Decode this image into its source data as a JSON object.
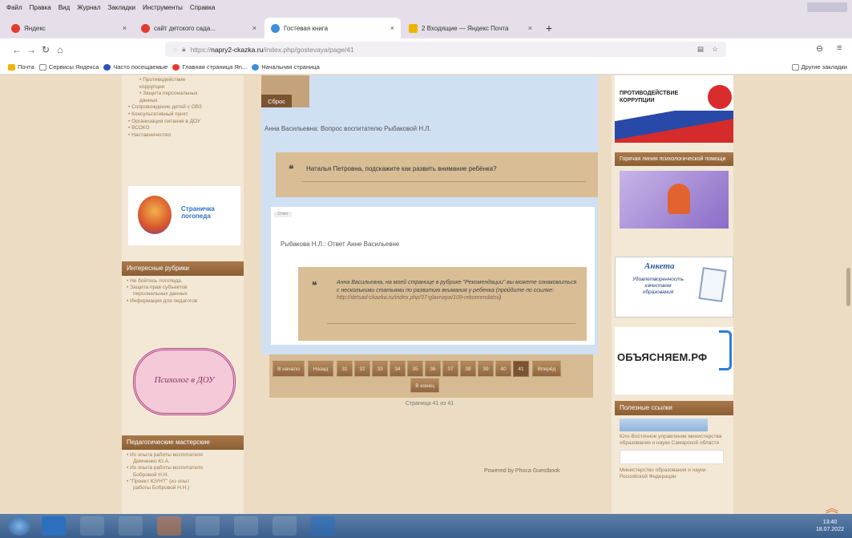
{
  "menubar": {
    "items": [
      "Файл",
      "Правка",
      "Вид",
      "Журнал",
      "Закладки",
      "Инструменты",
      "Справка"
    ]
  },
  "tabs": [
    {
      "label": "Яндекс",
      "color": "#e33b2e"
    },
    {
      "label": "сайт детского сада...",
      "color": "#e33b2e"
    },
    {
      "label": "Гостевая книга",
      "color": "#3d8edb",
      "active": true
    },
    {
      "label": "2 Входящие — Яндекс Почта",
      "color": "#f0b400"
    }
  ],
  "nav": {
    "url_prefix": "https://",
    "url_host": "napry2-ckazka.ru",
    "url_rest": "/index.php/gostevaya/page/41"
  },
  "bookmarks": {
    "items": [
      "Почта",
      "Сервисы Яндекса",
      "Часто посещаемые",
      "Главная страница Яn...",
      "Начальная страница"
    ],
    "other": "Другие закладки"
  },
  "left": {
    "nav_items": [
      {
        "label": "• Противодействие",
        "sub": true
      },
      {
        "label": "коррупции",
        "sub": true
      },
      {
        "label": "• Защита персональных",
        "sub": true
      },
      {
        "label": "данных",
        "sub": true
      },
      {
        "label": "• Сопровождение детей с ОВЗ",
        "sub": false
      },
      {
        "label": "• Консультативный пункт",
        "sub": false
      },
      {
        "label": "• Организация питания в ДОУ",
        "sub": false
      },
      {
        "label": "• ВСОКО",
        "sub": false
      },
      {
        "label": "• Наставничество",
        "sub": false
      }
    ],
    "speech_logo": "Страничка логопеда",
    "interesting": {
      "title": "Интересные рубрики",
      "items": [
        "• Не бойтесь логопеда",
        "• Защита прав субъектов",
        "персональных данных",
        "• Информация для педагогов"
      ]
    },
    "psych_logo": "Психолог в ДОУ",
    "masterclass": {
      "title": "Педагогические мастерские",
      "items": [
        "• Из опыта работы воспитателя",
        "Демченко Ю.А.",
        "• Из опыта работы воспитателя",
        "Бобровой Н.Н.",
        "• \"Проект ЮУНТ\" (из опыт",
        "работы Бобровой Н.Н.)"
      ]
    }
  },
  "main": {
    "back": "Сброс",
    "thread_title": "Анна Васильевна: Вопрос воспитателю Рыбаковой Н.Л.",
    "question": "Наталья Петровна, подскажите как развить внимание ребёнка?",
    "small_tag": "Ответ",
    "answer_title": "Рыбакова Н.Л.: Ответ Анне Васильевне",
    "answer_text": "Анна Васильевна, на моей странице в рубрике \"Рекомендации\" вы можете ознакомиться с несколькими статьями по развитию внимания у ребенка (пройдите по ссылке: ",
    "answer_link": "http://detsad-ckazka.ru/index.php/37-glavnaya/109-rekomendatsii",
    "answer_end": ")",
    "pager": {
      "first": "В начало",
      "prev": "Назад",
      "pages": [
        "31",
        "32",
        "33",
        "34",
        "35",
        "36",
        "37",
        "38",
        "39",
        "40",
        "41"
      ],
      "next": "Вперёд",
      "last": "В конец"
    },
    "page_count": "Страница 41 из 41",
    "powered": "Powered by Phoca Guestbook"
  },
  "right": {
    "anticorr": "ПРОТИВОДЕЙСТВИЕ КОРРУПЦИИ",
    "hotline_title": "Горячая линия психологической помощи",
    "anketa_title": "Анкета",
    "anketa_sub": "Удовлетворенность качеством образования",
    "obyasnyaem": "ОБЪЯСНЯЕМ.РФ",
    "useful_title": "Полезные ссылки",
    "useful_items": [
      "Юго-Восточное управление министерства образования и науки Самарской области",
      "Министерство образования и науки Российской Федерации"
    ]
  },
  "taskbar": {
    "time": "13:40",
    "date": "18.07.2022"
  }
}
